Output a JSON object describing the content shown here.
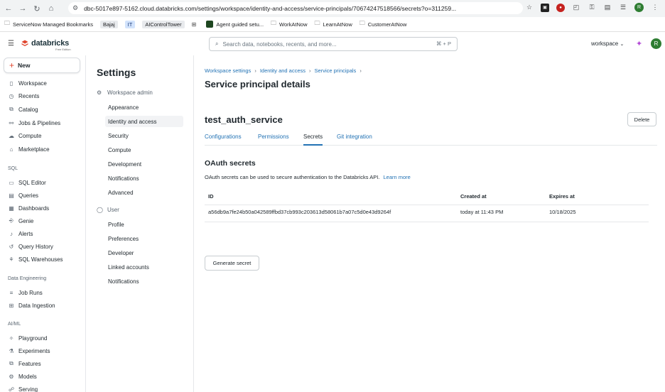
{
  "browser": {
    "url": "dbc-5017e897-5162.cloud.databricks.com/settings/workspace/identity-and-access/service-principals/70674247518566/secrets?o=311259...",
    "profile_initial": "R",
    "bookmarks": [
      {
        "label": "ServiceNow Managed Bookmarks",
        "icon": "folder-icon"
      },
      {
        "label": "Bajaj",
        "icon": ""
      },
      {
        "label": "IT",
        "icon": ""
      },
      {
        "label": "AIControlTower",
        "icon": ""
      },
      {
        "label": "",
        "icon": "apps-grid-icon"
      },
      {
        "label": "Agent guided setu...",
        "icon": "square-icon"
      },
      {
        "label": "WorkAtNow",
        "icon": "folder-icon"
      },
      {
        "label": "LearnAtNow",
        "icon": "folder-icon"
      },
      {
        "label": "CustomerAtNow",
        "icon": "folder-icon"
      }
    ]
  },
  "header": {
    "logo_text": "databricks",
    "logo_sub": "Free Edition",
    "search_placeholder": "Search data, notebooks, recents, and more...",
    "search_shortcut": "⌘ + P",
    "workspace_label": "workspace",
    "user_initial": "R",
    "brand_color": "#e0452e",
    "accent_color": "#2272b4"
  },
  "sidebar": {
    "new_label": "New",
    "items": [
      {
        "label": "Workspace",
        "icon": "workspace-icon"
      },
      {
        "label": "Recents",
        "icon": "clock-icon"
      },
      {
        "label": "Catalog",
        "icon": "catalog-icon"
      },
      {
        "label": "Jobs & Pipelines",
        "icon": "jobs-icon"
      },
      {
        "label": "Compute",
        "icon": "cloud-icon"
      },
      {
        "label": "Marketplace",
        "icon": "store-icon"
      }
    ],
    "sql_section": "SQL",
    "sql_items": [
      {
        "label": "SQL Editor",
        "icon": "editor-icon"
      },
      {
        "label": "Queries",
        "icon": "queries-icon"
      },
      {
        "label": "Dashboards",
        "icon": "dashboard-icon"
      },
      {
        "label": "Genie",
        "icon": "genie-icon"
      },
      {
        "label": "Alerts",
        "icon": "bell-icon"
      },
      {
        "label": "Query History",
        "icon": "history-icon"
      },
      {
        "label": "SQL Warehouses",
        "icon": "warehouse-icon"
      }
    ],
    "de_section": "Data Engineering",
    "de_items": [
      {
        "label": "Job Runs",
        "icon": "runs-icon"
      },
      {
        "label": "Data Ingestion",
        "icon": "ingestion-icon"
      }
    ],
    "ml_section": "AI/ML",
    "ml_items": [
      {
        "label": "Playground",
        "icon": "playground-icon"
      },
      {
        "label": "Experiments",
        "icon": "experiments-icon"
      },
      {
        "label": "Features",
        "icon": "features-icon"
      },
      {
        "label": "Models",
        "icon": "models-icon"
      },
      {
        "label": "Serving",
        "icon": "serving-icon"
      }
    ]
  },
  "settings": {
    "title": "Settings",
    "admin_group": "Workspace admin",
    "admin_items": [
      "Appearance",
      "Identity and access",
      "Security",
      "Compute",
      "Development",
      "Notifications",
      "Advanced"
    ],
    "user_group": "User",
    "user_items": [
      "Profile",
      "Preferences",
      "Developer",
      "Linked accounts",
      "Notifications"
    ]
  },
  "main": {
    "breadcrumbs": [
      "Workspace settings",
      "Identity and access",
      "Service principals"
    ],
    "page_title": "Service principal details",
    "principal_name": "test_auth_service",
    "delete_label": "Delete",
    "tabs": [
      "Configurations",
      "Permissions",
      "Secrets",
      "Git integration"
    ],
    "section_title": "OAuth secrets",
    "section_desc": "OAuth secrets can be used to secure authentication to the Databricks API.",
    "learn_more": "Learn more",
    "table": {
      "headers": [
        "ID",
        "Created at",
        "Expires at"
      ],
      "rows": [
        [
          "a56db9a7fe24b50a042589ffbd37cb993c203613d58061b7a07c5d0e43d9264f",
          "today at 11:43 PM",
          "10/18/2025"
        ]
      ]
    },
    "generate_label": "Generate secret"
  }
}
